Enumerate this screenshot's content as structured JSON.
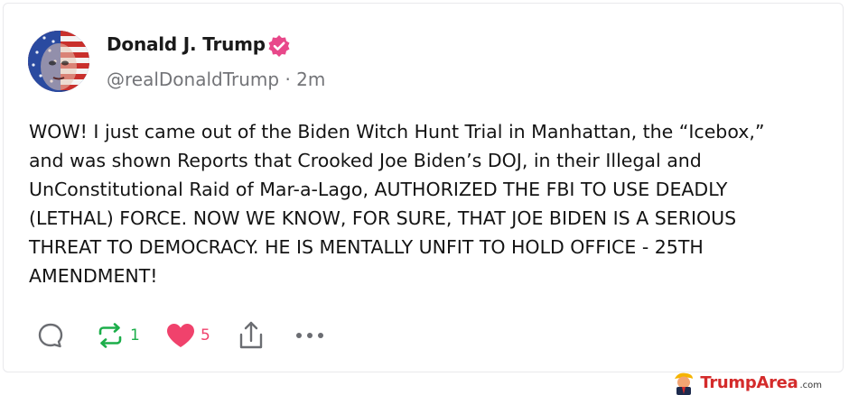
{
  "post": {
    "author_name": "Donald J. Trump",
    "handle": "@realDonaldTrump",
    "separator": "·",
    "time": "2m",
    "text_lines": [
      "WOW! I just came out of the Biden Witch Hunt Trial in Manhattan, the “Icebox,”",
      "and was shown Reports that Crooked Joe Biden’s DOJ, in their Illegal and",
      "UnConstitutional Raid of Mar-a-Lago, AUTHORIZED THE FBI TO USE DEADLY",
      "(LETHAL) FORCE. NOW WE KNOW, FOR SURE, THAT JOE BIDEN IS A SERIOUS",
      "THREAT TO DEMOCRACY. HE IS MENTALLY UNFIT TO HOLD OFFICE -  25TH",
      "AMENDMENT!"
    ]
  },
  "actions": {
    "reply_icon": "reply-icon",
    "repost_icon": "repost-icon",
    "repost_count": "1",
    "like_icon": "heart-icon",
    "like_count": "5",
    "share_icon": "share-icon",
    "more_icon": "more-icon"
  },
  "colors": {
    "verified_badge": "#e8488a",
    "repost_green": "#1cae4a",
    "like_red": "#f0426c",
    "muted_text": "#737478",
    "brand_red": "#d42b2b"
  },
  "watermark": {
    "brand_name": "TrumpArea",
    "domain_suffix": ".com"
  }
}
